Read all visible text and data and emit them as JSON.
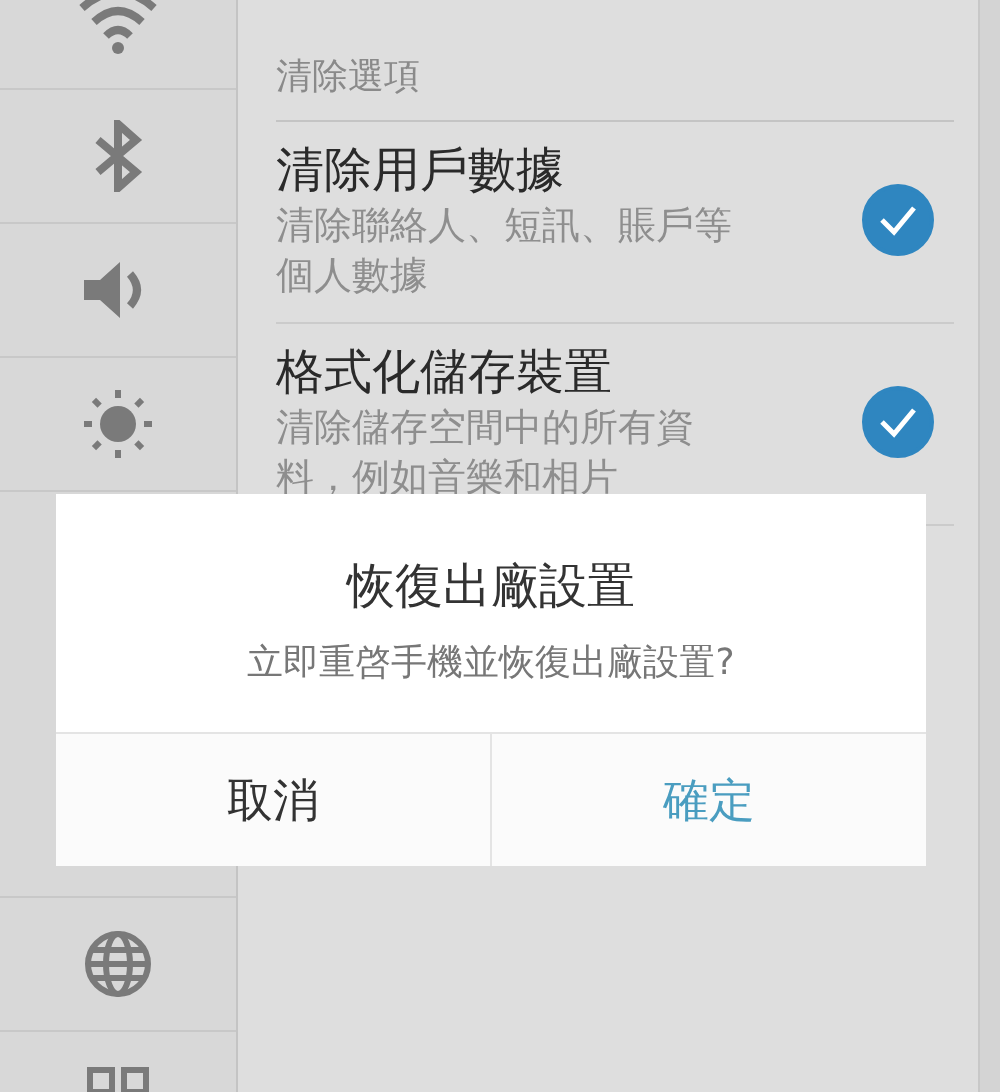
{
  "sidebar": {
    "top_items": [
      {
        "kind": "wifi"
      },
      {
        "kind": "bluetooth"
      },
      {
        "kind": "volume"
      },
      {
        "kind": "brightness"
      }
    ],
    "bottom_items": [
      {
        "kind": "globe"
      },
      {
        "kind": "grid"
      }
    ]
  },
  "panel": {
    "section_title": "清除選項",
    "options": [
      {
        "title": "清除用戶數據",
        "description": "清除聯絡人、短訊、賬戶等個人數據",
        "checked": true
      },
      {
        "title": "格式化儲存裝置",
        "description": "清除儲存空間中的所有資料，例如音樂和相片",
        "checked": true
      }
    ]
  },
  "dialog": {
    "title": "恢復出廠設置",
    "message": "立即重啓手機並恢復出廠設置?",
    "buttons": [
      {
        "label": "取消",
        "kind": "cancel"
      },
      {
        "label": "確定",
        "kind": "confirm"
      }
    ]
  }
}
